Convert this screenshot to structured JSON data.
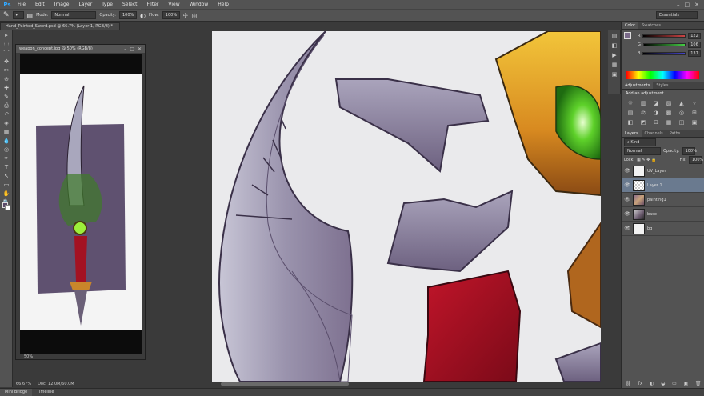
{
  "app": {
    "logo": "Ps"
  },
  "menubar": {
    "items": [
      "File",
      "Edit",
      "Image",
      "Layer",
      "Type",
      "Select",
      "Filter",
      "View",
      "Window",
      "Help"
    ]
  },
  "window_controls": {
    "minimize": "–",
    "maximize": "□",
    "close": "✕"
  },
  "options": {
    "mode_label": "Mode:",
    "mode_value": "Normal",
    "opacity_label": "Opacity:",
    "opacity_value": "100%",
    "flow_label": "Flow:",
    "flow_value": "100%",
    "workspace": "Essentials"
  },
  "doc_tab": {
    "title": "Hand_Painted_Sword.psd @ 66.7% (Layer 1, RGB/8) *"
  },
  "float_window": {
    "title": "weapon_concept.jpg @ 50% (RGB/8)",
    "zoom": "50%"
  },
  "status": {
    "zoom": "66.67%",
    "doc": "Doc: 12.0M/60.0M"
  },
  "bottom_tabs": [
    "Mini Bridge",
    "Timeline"
  ],
  "color_panel": {
    "tabs": [
      "Color",
      "Swatches"
    ],
    "sliders": [
      {
        "label": "R",
        "value": "122",
        "color": "#c44"
      },
      {
        "label": "G",
        "value": "106",
        "color": "#4c4"
      },
      {
        "label": "B",
        "value": "137",
        "color": "#44c"
      }
    ]
  },
  "adjustments_panel": {
    "tabs": [
      "Adjustments",
      "Styles"
    ],
    "heading": "Add an adjustment",
    "icons": [
      "☼",
      "▥",
      "◪",
      "▧",
      "◭",
      "▿",
      "▤",
      "⚖",
      "◑",
      "▩",
      "◎",
      "⊞",
      "◧",
      "◩",
      "⊟",
      "▦",
      "◫",
      "▣"
    ]
  },
  "layers_panel": {
    "tabs": [
      "Layers",
      "Channels",
      "Paths"
    ],
    "kind_label": "Kind",
    "blend_mode": "Normal",
    "opacity_label": "Opacity:",
    "opacity_value": "100%",
    "lock_label": "Lock:",
    "fill_label": "Fill:",
    "fill_value": "100%",
    "layers": [
      {
        "name": "UV_Layer",
        "thumb": "white",
        "selected": false
      },
      {
        "name": "Layer 1",
        "thumb": "check",
        "selected": true
      },
      {
        "name": "painting1",
        "thumb": "paint",
        "selected": false
      },
      {
        "name": "base",
        "thumb": "base",
        "selected": false
      },
      {
        "name": "bg",
        "thumb": "white",
        "selected": false
      }
    ],
    "footer_icons": [
      "⛓",
      "fx",
      "◐",
      "◒",
      "▭",
      "▣",
      "🗑"
    ]
  },
  "tools": [
    "▸",
    "⬚",
    "⌒",
    "✥",
    "✂",
    "⊘",
    "✚",
    "✎",
    "⎙",
    "↶",
    "◈",
    "▦",
    "💧",
    "◎",
    "✒",
    "T",
    "↖",
    "▭",
    "✋",
    "🔍"
  ],
  "dock_icons": [
    "▤",
    "◧",
    "▶",
    "▦",
    "▣"
  ]
}
